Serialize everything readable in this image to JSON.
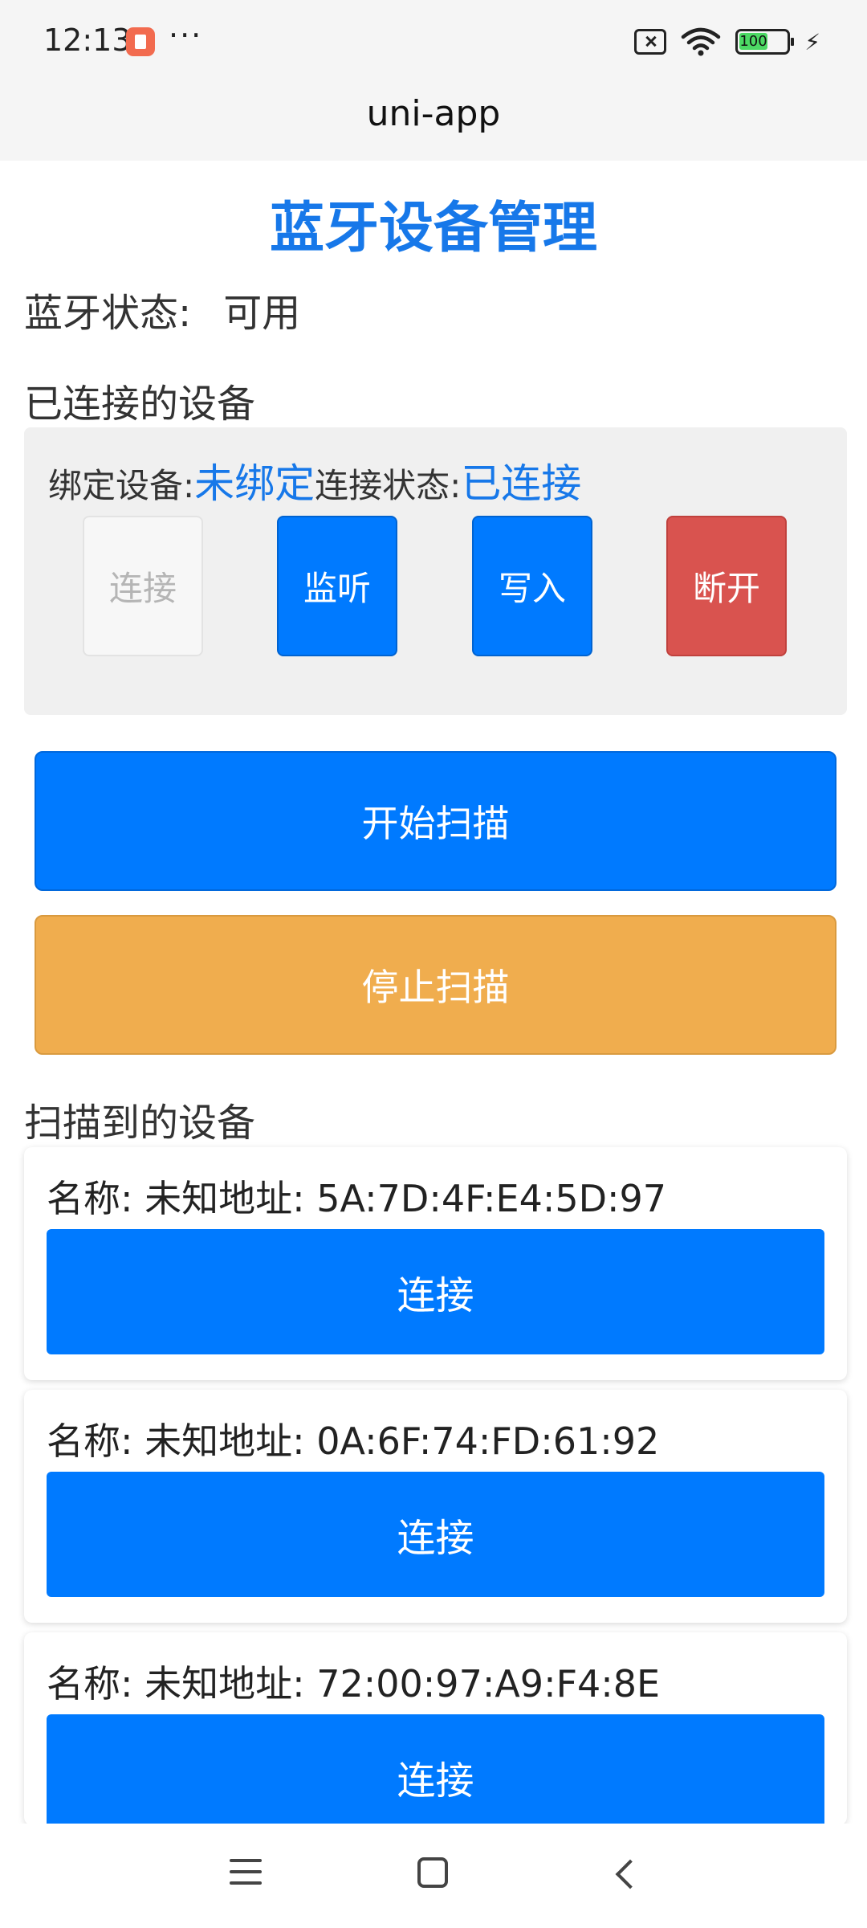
{
  "status_bar": {
    "time": "12:13",
    "more": "···",
    "battery": "100"
  },
  "nav": {
    "title": "uni-app"
  },
  "page": {
    "title": "蓝牙设备管理",
    "bt_status_label": "蓝牙状态:",
    "bt_status_value": "可用"
  },
  "connected": {
    "section_title": "已连接的设备",
    "bind_label": "绑定设备:",
    "bind_value": "未绑定",
    "conn_label": "连接状态:",
    "conn_value": "已连接",
    "buttons": {
      "connect": "连接",
      "listen": "监听",
      "write": "写入",
      "disconnect": "断开"
    }
  },
  "scan": {
    "start_label": "开始扫描",
    "stop_label": "停止扫描",
    "section_title": "扫描到的设备",
    "devices": [
      {
        "info": "名称: 未知地址: 5A:7D:4F:E4:5D:97",
        "connect_label": "连接"
      },
      {
        "info": "名称: 未知地址: 0A:6F:74:FD:61:92",
        "connect_label": "连接"
      },
      {
        "info": "名称: 未知地址: 72:00:97:A9:F4:8E",
        "connect_label": "连接"
      }
    ]
  },
  "colors": {
    "primary": "#007aff",
    "title_blue": "#1778e9",
    "warn": "#f0ad4e",
    "danger": "#d9534f"
  }
}
